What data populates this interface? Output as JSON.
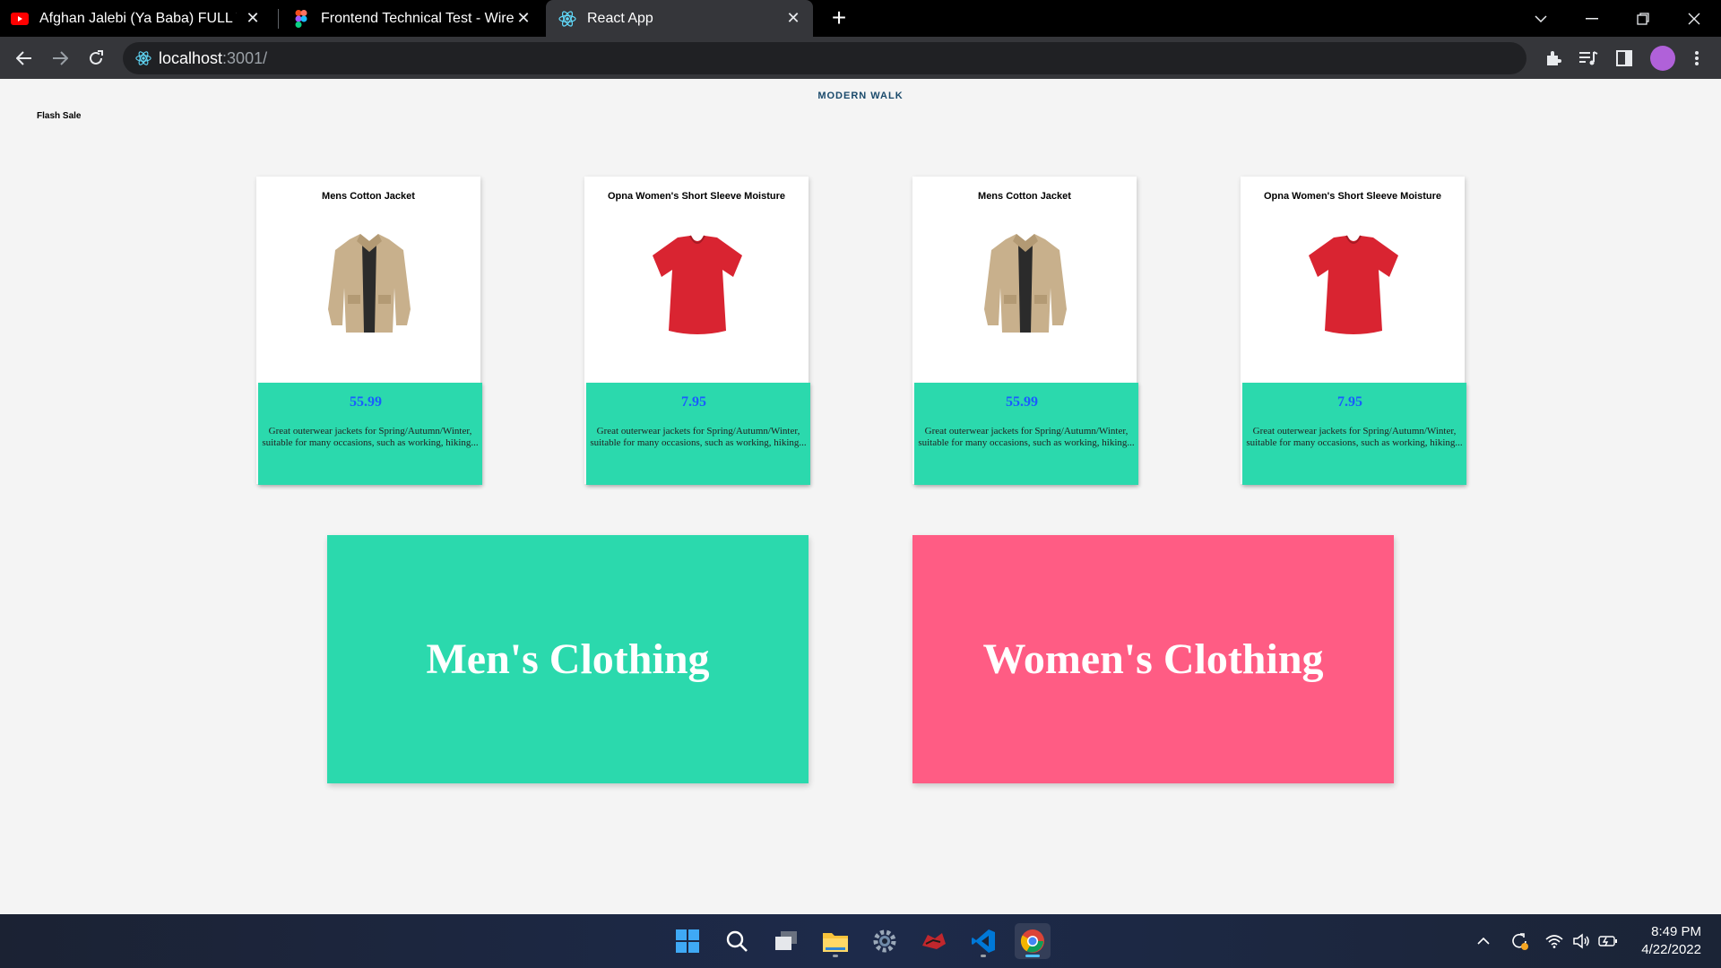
{
  "browser": {
    "tabs": [
      {
        "title": "Afghan Jalebi (Ya Baba) FULL VIDEO"
      },
      {
        "title": "Frontend Technical Test - Wireapp"
      },
      {
        "title": "React App"
      }
    ],
    "url_host": "localhost",
    "url_rest": ":3001/"
  },
  "page": {
    "brand": "MODERN WALK",
    "flash_sale": "Flash Sale",
    "products": [
      {
        "title": "Mens Cotton Jacket",
        "price": "55.99",
        "description": "Great outerwear jackets for Spring/Autumn/Winter, suitable for many occasions, such as working, hiking...",
        "image": "jacket-image"
      },
      {
        "title": "Opna Women's Short Sleeve Moisture",
        "price": "7.95",
        "description": "Great outerwear jackets for Spring/Autumn/Winter, suitable for many occasions, such as working, hiking...",
        "image": "tshirt-image"
      },
      {
        "title": "Mens Cotton Jacket",
        "price": "55.99",
        "description": "Great outerwear jackets for Spring/Autumn/Winter, suitable for many occasions, such as working, hiking...",
        "image": "jacket-image"
      },
      {
        "title": "Opna Women's Short Sleeve Moisture",
        "price": "7.95",
        "description": "Great outerwear jackets for Spring/Autumn/Winter, suitable for many occasions, such as working, hiking...",
        "image": "tshirt-image"
      }
    ],
    "categories": [
      {
        "label": "Men's Clothing",
        "color": "#2bd9ad"
      },
      {
        "label": "Women's Clothing",
        "color": "#ff5c84"
      }
    ]
  },
  "taskbar": {
    "time": "8:49 PM",
    "date": "4/22/2022",
    "apps": [
      "start-icon",
      "search-icon",
      "task-view-icon",
      "file-explorer-icon",
      "settings-icon",
      "game-app-icon",
      "vscode-icon",
      "chrome-icon"
    ]
  },
  "colors": {
    "card_teal": "#2bd9ad",
    "price_blue": "#1a5cff",
    "women_pink": "#ff5c84",
    "brand": "#1a4a6b"
  }
}
